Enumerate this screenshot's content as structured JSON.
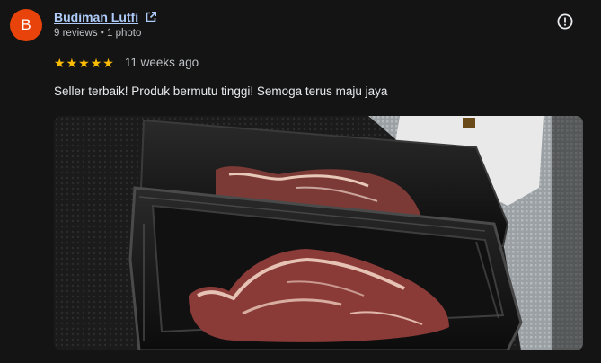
{
  "review": {
    "author": {
      "initial": "B",
      "name": "Budiman Lutfi",
      "meta": "9 reviews • 1 photo",
      "avatar_color": "#e8430a"
    },
    "rating": {
      "stars": 5,
      "max": 5,
      "star_color": "#fbbc04",
      "date": "11 weeks ago"
    },
    "text": "Seller terbaik! Produk bermutu tinggi! Semoga terus maju jaya",
    "icons": {
      "external": "open-in-new-icon",
      "report": "report-icon"
    },
    "photo": {
      "subject": "raw beef steaks in black plastic trays"
    }
  }
}
